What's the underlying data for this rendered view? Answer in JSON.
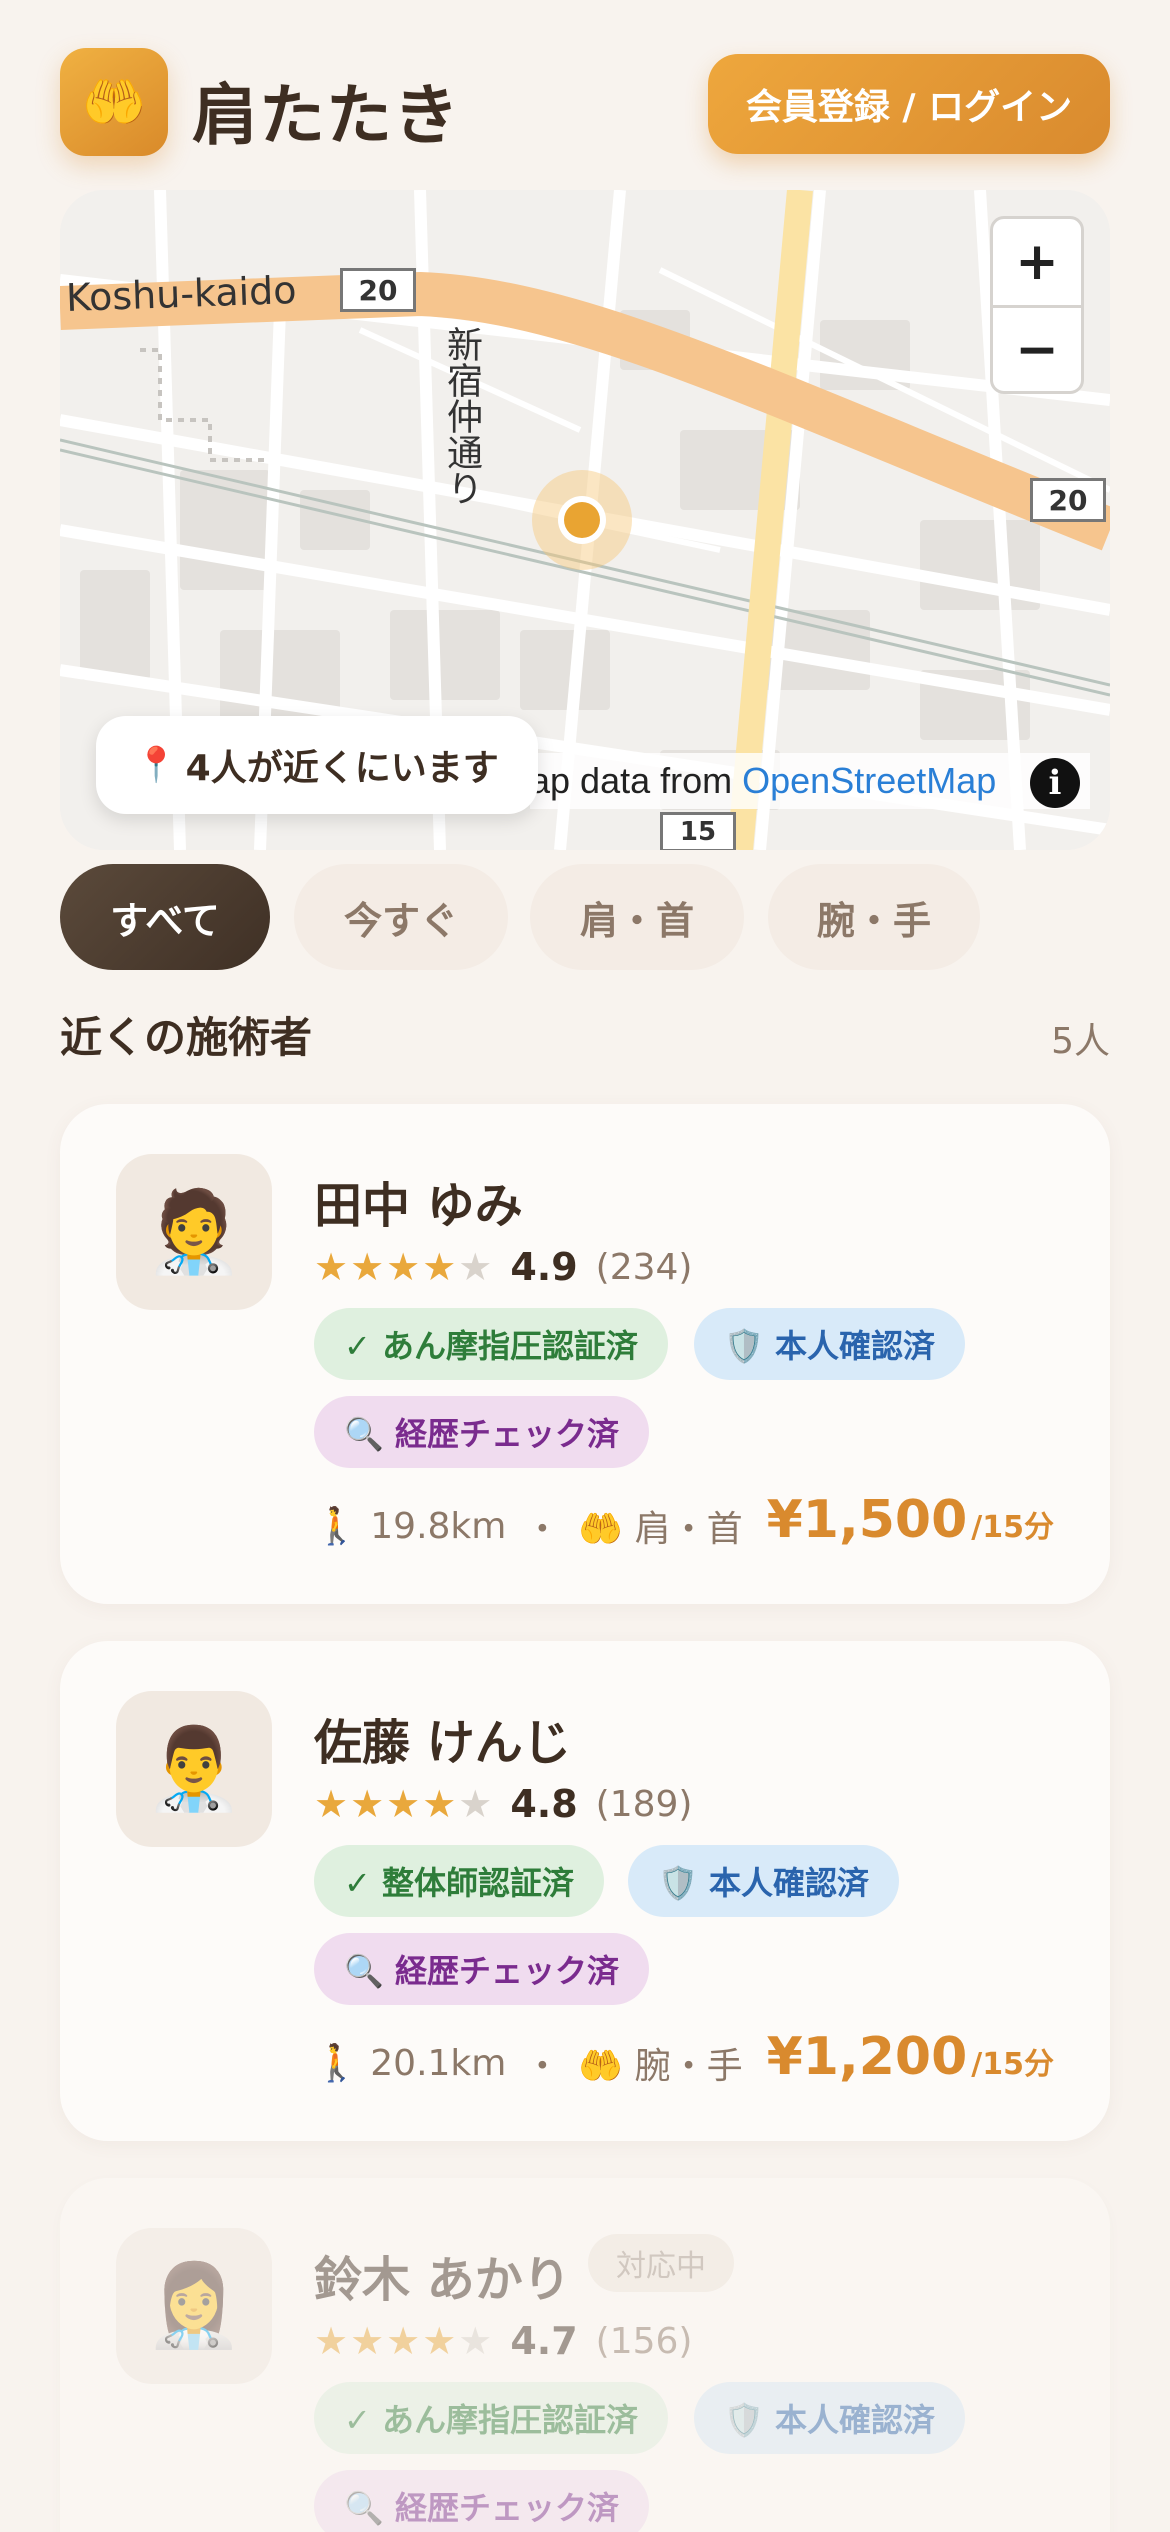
{
  "header": {
    "logo_icon": "🤲",
    "title": "肩たたき",
    "login_label": "会員登録 / ログイン"
  },
  "map": {
    "road_labels": {
      "koshu": "Koshu-kaido",
      "route20a": "20",
      "route20b": "20",
      "route15": "15",
      "shinjuku": "新宿仲通り"
    },
    "zoom_in": "+",
    "zoom_out": "−",
    "nearby_icon": "📍",
    "nearby_text": "4人が近くにいます",
    "attribution_prefix": "ap data from",
    "attribution_link": "OpenStreetMap",
    "info_icon": "i",
    "colors": {
      "road_main": "#f6c58e",
      "road_yellow": "#fbe3a4",
      "marker": "#e9a432"
    }
  },
  "filters": [
    {
      "label": "すべて",
      "active": true
    },
    {
      "label": "今すぐ",
      "active": false
    },
    {
      "label": "肩・首",
      "active": false
    },
    {
      "label": "腕・手",
      "active": false
    }
  ],
  "section": {
    "title": "近くの施術者",
    "count": "5人"
  },
  "practitioners": [
    {
      "avatar": "🧑‍⚕️",
      "name": "田中 ゆみ",
      "stars": 4,
      "score": "4.9",
      "reviews": "(234)",
      "badge_license": "✓ あん摩指圧認証済",
      "badge_id": "🛡️ 本人確認済",
      "badge_history": "🔍 経歴チェック済",
      "distance": "🚶 19.8km",
      "separator": "・",
      "area": "🤲 肩・首",
      "price": "¥1,500",
      "unit": "/15分"
    },
    {
      "avatar": "👨‍⚕️",
      "name": "佐藤 けんじ",
      "stars": 4,
      "score": "4.8",
      "reviews": "(189)",
      "badge_license": "✓ 整体師認証済",
      "badge_id": "🛡️ 本人確認済",
      "badge_history": "🔍 経歴チェック済",
      "distance": "🚶 20.1km",
      "separator": "・",
      "area": "🤲 腕・手",
      "price": "¥1,200",
      "unit": "/15分"
    },
    {
      "avatar": "👩‍⚕️",
      "name": "鈴木 あかり",
      "status": "対応中",
      "stars": 4,
      "score": "4.7",
      "reviews": "(156)",
      "badge_license": "✓ あん摩指圧認証済",
      "badge_id": "🛡️ 本人確認済",
      "badge_history": "🔍 経歴チェック済"
    }
  ]
}
